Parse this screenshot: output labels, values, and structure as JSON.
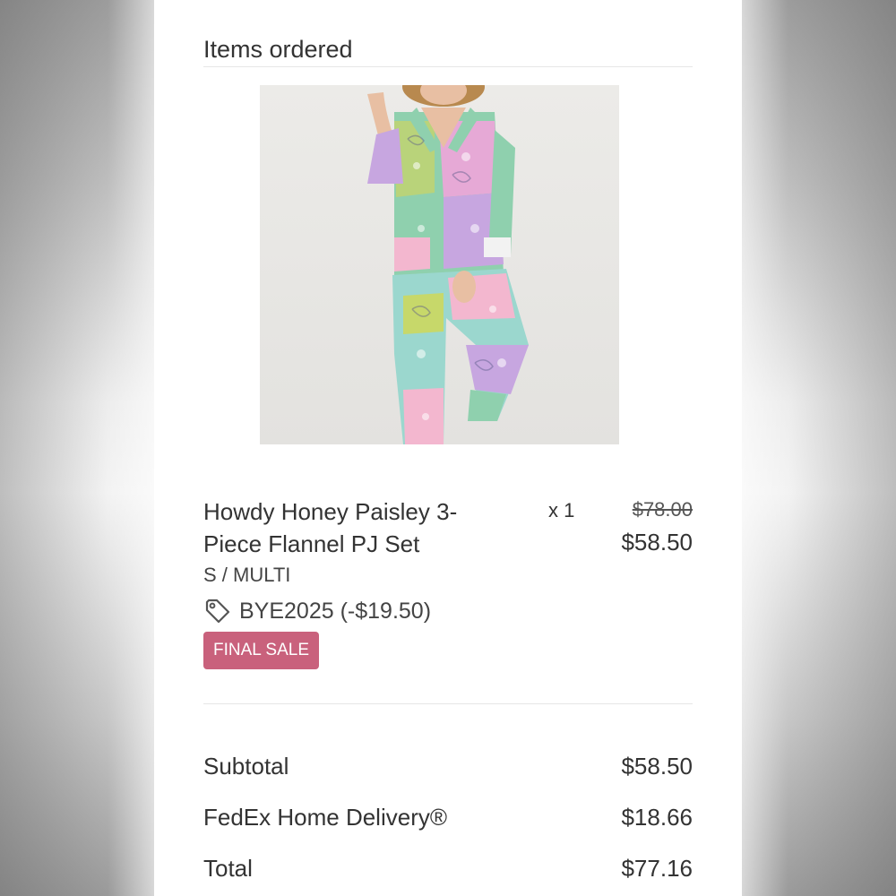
{
  "section": {
    "title": "Items ordered"
  },
  "item": {
    "image_alt": "Model wearing patchwork paisley pajama set",
    "name": "Howdy Honey Paisley 3-Piece Flannel PJ Set",
    "quantity": "x 1",
    "original_price": "$78.00",
    "final_price": "$58.50",
    "variant": "S / MULTI",
    "discount_code": "BYE2025 (-$19.50)",
    "discount_icon": "tag-icon",
    "badge": "FINAL SALE"
  },
  "summary": {
    "rows": [
      {
        "label": "Subtotal",
        "value": "$58.50"
      },
      {
        "label": "FedEx Home Delivery®",
        "value": "$18.66"
      },
      {
        "label": "Total",
        "value": "$77.16"
      }
    ]
  },
  "colors": {
    "badge_bg": "#c9617c",
    "text": "#333333",
    "divider": "#e6e6e6"
  }
}
